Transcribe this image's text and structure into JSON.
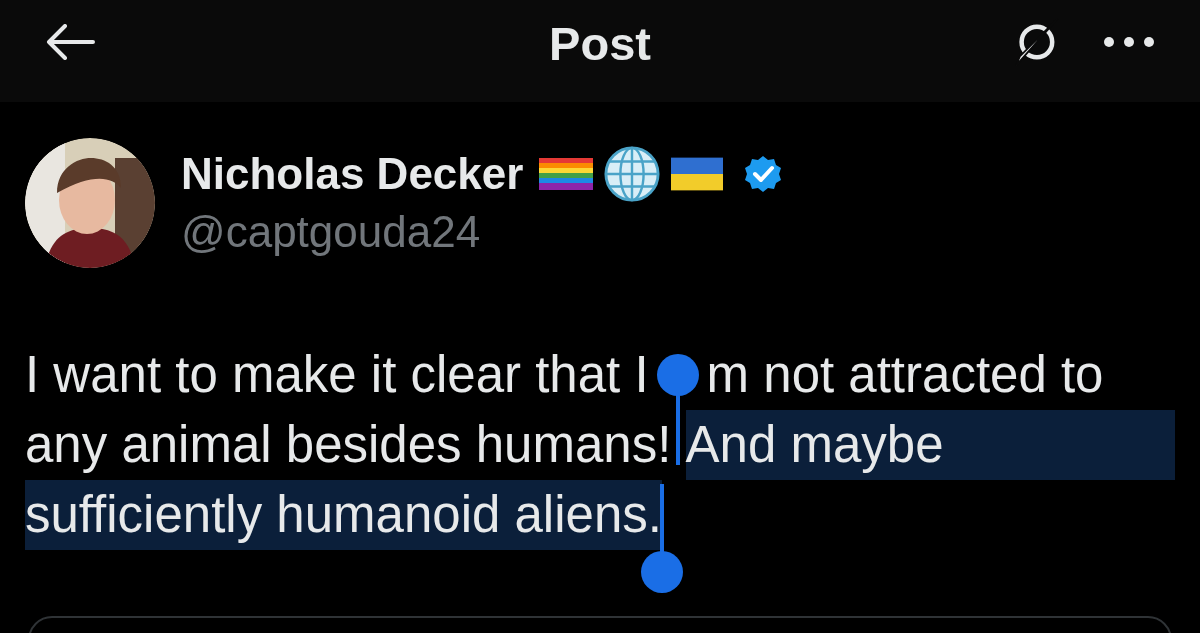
{
  "header": {
    "title": "Post"
  },
  "author": {
    "name": "Nicholas Decker",
    "handle": "@captgouda24",
    "verified": true
  },
  "body": {
    "lines": [
      [
        {
          "text": "I want to make it clear that I",
          "selected": false
        },
        {
          "kind": "start_handle"
        },
        {
          "text": "m not attracted to",
          "selected": false
        }
      ],
      [
        {
          "text": "any animal besides humans! ",
          "selected": false
        },
        {
          "text": "And maybe",
          "selected": true
        }
      ],
      [
        {
          "text": "sufficiently humanoid aliens.",
          "selected": true
        },
        {
          "kind": "end_handle"
        }
      ]
    ]
  }
}
